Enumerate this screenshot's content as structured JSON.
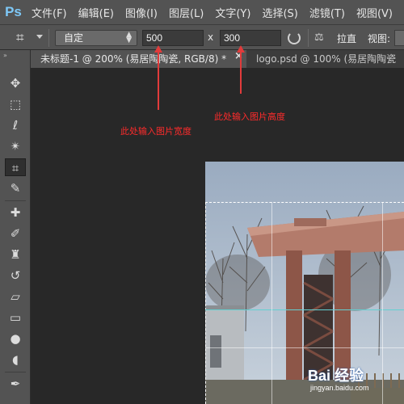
{
  "app": {
    "logo": "Ps"
  },
  "menu": [
    "文件(F)",
    "编辑(E)",
    "图像(I)",
    "图层(L)",
    "文字(Y)",
    "选择(S)",
    "滤镜(T)",
    "视图(V)"
  ],
  "options": {
    "preset": "自定",
    "width": "500",
    "height": "300",
    "x_sign": "x",
    "straighten_label": "拉直",
    "view_label": "视图:"
  },
  "tabs": {
    "active": "未标题-1 @ 200% (易居陶陶瓷, RGB/8) *",
    "close": "×",
    "inactive": "logo.psd @ 100% (易居陶陶瓷"
  },
  "annotations": {
    "height_note": "此处输入图片高度",
    "width_note": "此处输入图片宽度"
  },
  "watermark": {
    "brand": "Bai 经验",
    "url": "jingyan.baidu.com"
  },
  "colors": {
    "annotation": "#ff2b2b",
    "panel": "#535353",
    "workspace": "#282828"
  }
}
